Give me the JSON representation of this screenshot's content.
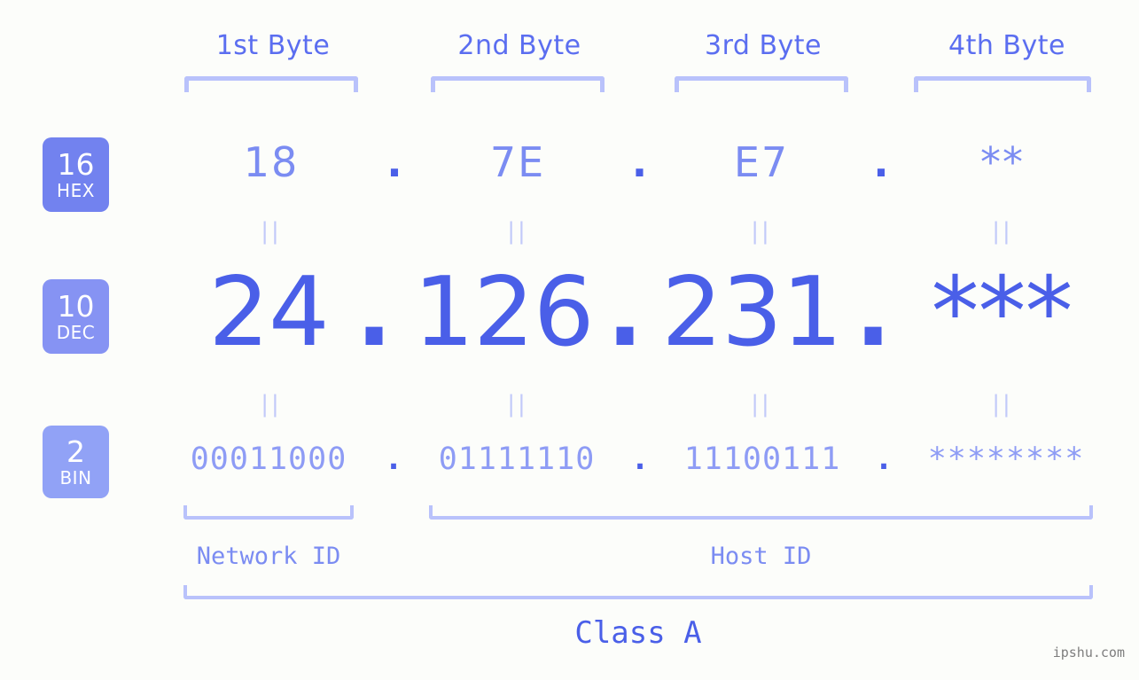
{
  "page": {
    "background_color": "#fcfdfa",
    "accent_color": "#4a5fe8",
    "accent_light_color": "#7b8cf2",
    "bracket_color": "#b9c2fb",
    "watermark": "ipshu.com"
  },
  "byte_headers": [
    {
      "label": "1st Byte"
    },
    {
      "label": "2nd Byte"
    },
    {
      "label": "3rd Byte"
    },
    {
      "label": "4th Byte"
    }
  ],
  "bases": [
    {
      "number": "16",
      "abbr": "HEX",
      "color": "#7282ef"
    },
    {
      "number": "10",
      "abbr": "DEC",
      "color": "#8693f3"
    },
    {
      "number": "2",
      "abbr": "BIN",
      "color": "#91a2f6"
    }
  ],
  "rows": {
    "hex": {
      "values": [
        "18",
        "7E",
        "E7",
        "**"
      ],
      "separator": "."
    },
    "dec": {
      "values": [
        "24",
        "126",
        "231",
        "***"
      ],
      "separator": "."
    },
    "bin": {
      "values": [
        "00011000",
        "01111110",
        "11100111",
        "********"
      ],
      "separator": "."
    }
  },
  "equality_marks": {
    "symbol": "||",
    "count_per_row": 4
  },
  "segments": {
    "network_id": "Network ID",
    "host_id": "Host ID",
    "class": "Class A"
  }
}
